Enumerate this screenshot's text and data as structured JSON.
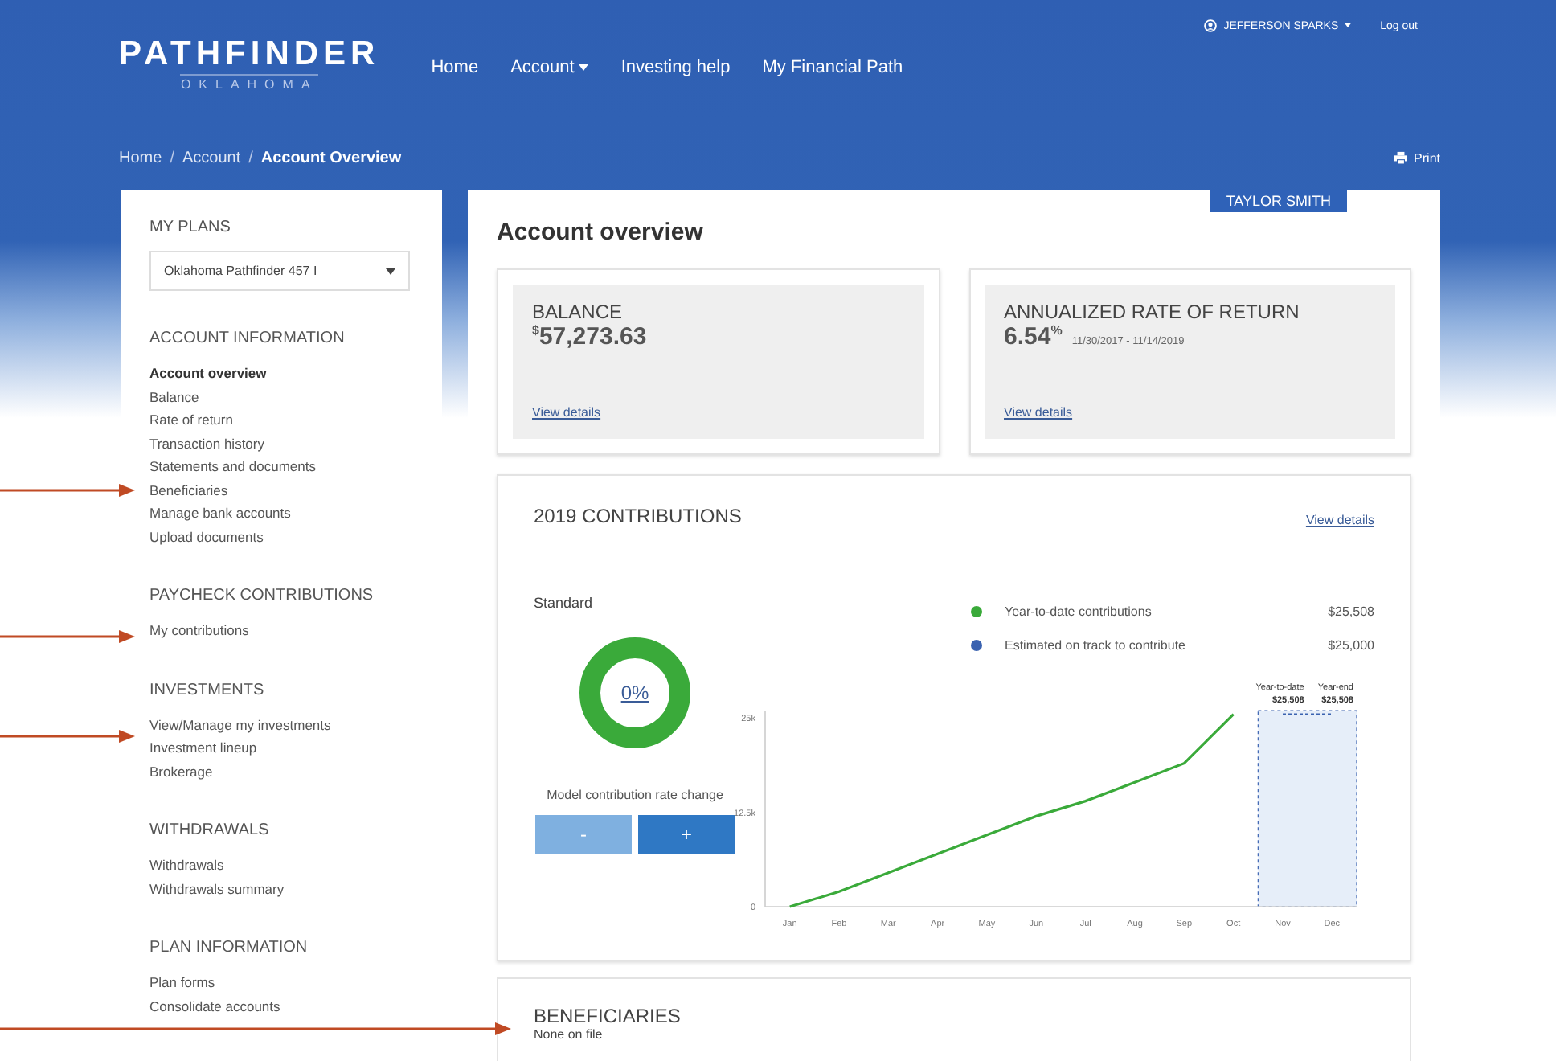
{
  "header": {
    "logo_name": "PATHFINDER",
    "logo_sub": "OKLAHOMA",
    "nav": [
      {
        "label": "Home",
        "dropdown": false
      },
      {
        "label": "Account",
        "dropdown": true
      },
      {
        "label": "Investing help",
        "dropdown": false
      },
      {
        "label": "My Financial Path",
        "dropdown": false
      }
    ],
    "user": "JEFFERSON SPARKS",
    "logout": "Log out"
  },
  "breadcrumb_separator": "/",
  "breadcrumb": [
    {
      "label": "Home",
      "current": false
    },
    {
      "label": "Account",
      "current": false
    },
    {
      "label": "Account Overview",
      "current": true
    }
  ],
  "print": "Print",
  "sidebar": {
    "plans_title": "MY PLANS",
    "plan_select": "Oklahoma Pathfinder 457 I",
    "sections": [
      {
        "title": "ACCOUNT INFORMATION",
        "items": [
          {
            "label": "Account overview",
            "selected": true
          },
          {
            "label": "Balance",
            "selected": false
          },
          {
            "label": "Rate of return",
            "selected": false
          },
          {
            "label": "Transaction history",
            "selected": false
          },
          {
            "label": "Statements and documents",
            "selected": false
          },
          {
            "label": "Beneficiaries",
            "selected": false
          },
          {
            "label": "Manage bank accounts",
            "selected": false
          },
          {
            "label": "Upload documents",
            "selected": false
          }
        ]
      },
      {
        "title": "PAYCHECK CONTRIBUTIONS",
        "items": [
          {
            "label": "My contributions",
            "selected": false
          }
        ]
      },
      {
        "title": "INVESTMENTS",
        "items": [
          {
            "label": "View/Manage my investments",
            "selected": false
          },
          {
            "label": "Investment lineup",
            "selected": false
          },
          {
            "label": "Brokerage",
            "selected": false
          }
        ]
      },
      {
        "title": "WITHDRAWALS",
        "items": [
          {
            "label": "Withdrawals",
            "selected": false
          },
          {
            "label": "Withdrawals summary",
            "selected": false
          }
        ]
      },
      {
        "title": "PLAN INFORMATION",
        "items": [
          {
            "label": "Plan forms",
            "selected": false
          },
          {
            "label": "Consolidate accounts",
            "selected": false
          }
        ]
      }
    ]
  },
  "main": {
    "participant": "TAYLOR SMITH",
    "title": "Account overview",
    "balance": {
      "title": "BALANCE",
      "currency": "$",
      "value": "57,273.63",
      "link": "View details"
    },
    "rate": {
      "title": "ANNUALIZED RATE OF RETURN",
      "value": "6.54",
      "unit": "%",
      "period": "11/30/2017 - 11/14/2019",
      "link": "View details"
    },
    "contributions": {
      "title": "2019 CONTRIBUTIONS",
      "link": "View details",
      "subtitle": "Standard",
      "rate": "0%",
      "model_label": "Model contribution rate change",
      "minus": "-",
      "plus": "+",
      "legend_values": [
        "$25,508",
        "$25,000"
      ],
      "chart_data": {
        "type": "line",
        "categories": [
          "Jan",
          "Feb",
          "Mar",
          "Apr",
          "May",
          "Jun",
          "Jul",
          "Aug",
          "Sep",
          "Oct",
          "Nov",
          "Dec"
        ],
        "series": [
          {
            "name": "Year-to-date contributions",
            "color": "#3aaa3a",
            "values": [
              0,
              2000,
              4500,
              7000,
              9500,
              12000,
              14000,
              16500,
              19000,
              25500,
              null,
              null
            ]
          },
          {
            "name": "Estimated on track to contribute",
            "color": "#3a62b0",
            "line_style": "dashed",
            "values": [
              null,
              null,
              null,
              null,
              null,
              null,
              null,
              null,
              null,
              null,
              25500,
              25500
            ]
          }
        ],
        "ylim": [
          0,
          26000
        ],
        "yticks": [
          {
            "value": 0,
            "label": "0"
          },
          {
            "value": 12500,
            "label": "12.5k"
          },
          {
            "value": 25000,
            "label": "25k"
          }
        ],
        "annotations": [
          "Year-to-date",
          "$25,508",
          "Year-end",
          "$25,508"
        ]
      }
    },
    "beneficiaries": {
      "title": "BENEFICIARIES",
      "text": "None on file"
    }
  },
  "callouts": [
    {
      "kind": "short"
    },
    {
      "kind": "short"
    },
    {
      "kind": "short"
    },
    {
      "kind": "long"
    }
  ]
}
